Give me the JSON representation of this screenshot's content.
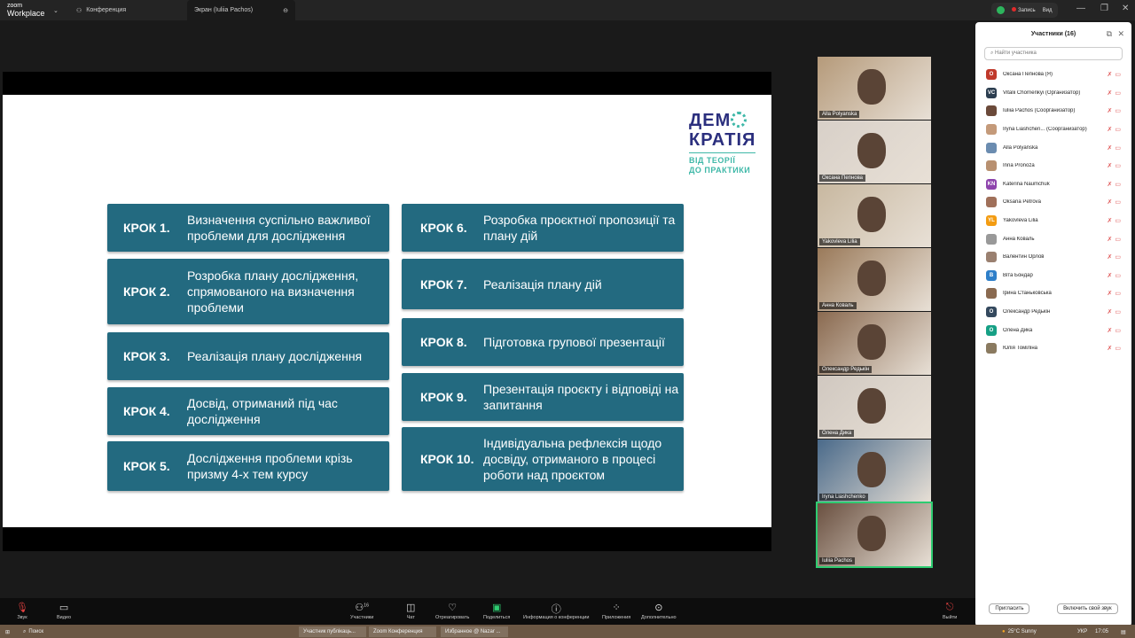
{
  "titlebar": {
    "logo_small": "zoom",
    "logo_big": "Workplace",
    "tab1": "Конференция",
    "tab2": "Экран (Iuliia Pachos)",
    "record": "Запись",
    "view": "Вид"
  },
  "slide": {
    "brand_line1": "ДЕМ",
    "brand_line2": "КРАТІЯ",
    "brand_sub1": "ВІД ТЕОРІЇ",
    "brand_sub2": "ДО ПРАКТИКИ",
    "steps_left": [
      {
        "k": "КРОК 1.",
        "t": "Визначення суспільно важливої проблеми для дослідження"
      },
      {
        "k": "КРОК 2.",
        "t": "Розробка плану дослідження, спрямованого на визначення проблеми"
      },
      {
        "k": "КРОК 3.",
        "t": "Реалізація плану дослідження"
      },
      {
        "k": "КРОК 4.",
        "t": "Досвід, отриманий під час дослідження"
      },
      {
        "k": "КРОК 5.",
        "t": "Дослідження проблеми крізь призму 4-х тем курсу"
      }
    ],
    "steps_right": [
      {
        "k": "КРОК 6.",
        "t": "Розробка проєктної пропозиції та плану дій"
      },
      {
        "k": "КРОК 7.",
        "t": "Реалізація плану дій"
      },
      {
        "k": "КРОК 8.",
        "t": "Підготовка групової презентації"
      },
      {
        "k": "КРОК 9.",
        "t": "Презентація проєкту і відповіді на запитання"
      },
      {
        "k": "КРОК 10.",
        "t": "Індивідуальна рефлексія щодо досвіду, отриманого в процесі роботи над проєктом"
      }
    ]
  },
  "videos": [
    "Alla Polyanska",
    "Оксана Пепнова",
    "Yakovleva Lilia",
    "Анна Коваль",
    "Олександр Редькін",
    "Олена Дика",
    "Iryna Liashchenko",
    "Iuliia Pachos"
  ],
  "panel": {
    "title": "Участники (16)",
    "search_placeholder": "Найти участника",
    "invite": "Пригласить",
    "unmute": "Включить свой звук",
    "participants": [
      {
        "n": "Оксана Пепнова (Я)",
        "a": "О",
        "c": "#c0392b"
      },
      {
        "n": "Vitalii Chornenkyi (Организатор)",
        "a": "VC",
        "c": "#2c3e50"
      },
      {
        "n": "Iuliia Pachos (Соорганизатор)",
        "a": "",
        "c": "#6b4a3a"
      },
      {
        "n": "Iryna Liashchen... (Соорганизатор)",
        "a": "",
        "c": "#c49a7a"
      },
      {
        "n": "Alla Polyanska",
        "a": "",
        "c": "#6b8cb0"
      },
      {
        "n": "Inna Pronoza",
        "a": "",
        "c": "#b89070"
      },
      {
        "n": "Katerina Naumchuk",
        "a": "KN",
        "c": "#8e44ad"
      },
      {
        "n": "Oksana Petrova",
        "a": "",
        "c": "#a0705a"
      },
      {
        "n": "Yakovleva Lilia",
        "a": "YL",
        "c": "#f39c12"
      },
      {
        "n": "Анна Коваль",
        "a": "",
        "c": "#999"
      },
      {
        "n": "Валентин Орлов",
        "a": "",
        "c": "#9a8070"
      },
      {
        "n": "Віта Бондар",
        "a": "В",
        "c": "#2e7fc9"
      },
      {
        "n": "Ірина Станьковська",
        "a": "",
        "c": "#8a6a50"
      },
      {
        "n": "Олександр Редькін",
        "a": "О",
        "c": "#34495e"
      },
      {
        "n": "Олена Дика",
        "a": "О",
        "c": "#16a085"
      },
      {
        "n": "Юлія Томіліна",
        "a": "",
        "c": "#8a7a60"
      }
    ]
  },
  "toolbar": {
    "audio": "Звук",
    "video": "Видео",
    "participants": "Участники",
    "participants_count": "16",
    "chat": "Чат",
    "react": "Отреагировать",
    "share": "Поделиться",
    "info": "Информация о конференции",
    "apps": "Приложения",
    "more": "Дополнительно",
    "leave": "Выйти"
  },
  "taskbar": {
    "search": "Поиск",
    "app1": "Участник публікаць...",
    "app2": "Zoom Конференция",
    "app3": "Избранное @ Nazar ...",
    "weather": "25°C  Sunny",
    "lang": "УКР",
    "time": "17:05"
  }
}
